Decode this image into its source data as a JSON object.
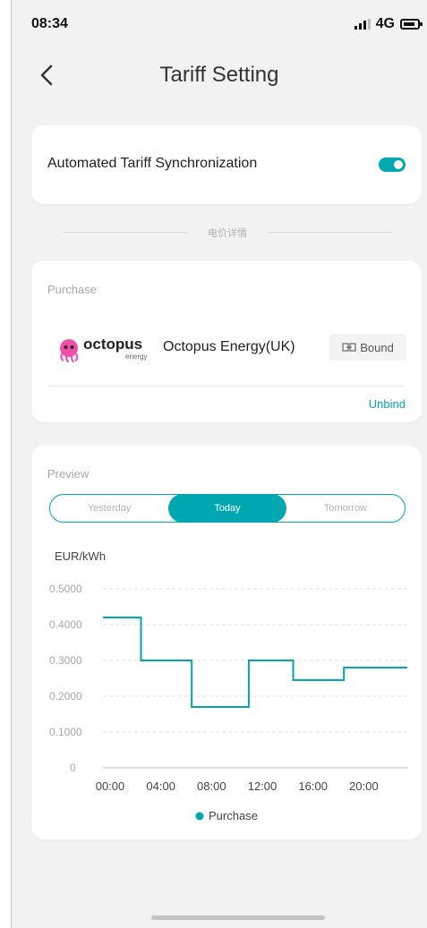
{
  "status_bar": {
    "time": "08:34",
    "network": "4G"
  },
  "header": {
    "title": "Tariff Setting"
  },
  "sync": {
    "label": "Automated Tariff Synchronization",
    "enabled": true
  },
  "section_divider": "电价详情",
  "purchase": {
    "caption": "Purchase",
    "logo_text": "octopus",
    "logo_subtext": "energy",
    "provider": "Octopus Energy(UK)",
    "status": "Bound",
    "unbind": "Unbind"
  },
  "preview": {
    "caption": "Preview",
    "tabs": [
      "Yesterday",
      "Today",
      "Tomorrow"
    ],
    "active_tab": "Today"
  },
  "colors": {
    "accent": "#00a6b0",
    "logo_pink": "#f050a8"
  },
  "chart_data": {
    "type": "line",
    "step": true,
    "ylabel": "EUR/kWh",
    "ylim": [
      0,
      0.5
    ],
    "yticks": [
      "0.5000",
      "0.4000",
      "0.3000",
      "0.2000",
      "0.1000",
      "0"
    ],
    "ytick_values": [
      0.5,
      0.4,
      0.3,
      0.2,
      0.1,
      0
    ],
    "xlim": [
      0,
      24
    ],
    "xticks": [
      "00:00",
      "04:00",
      "08:00",
      "12:00",
      "16:00",
      "20:00"
    ],
    "xtick_values": [
      0,
      4,
      8,
      12,
      16,
      20
    ],
    "grid": true,
    "legend": "bottom",
    "series": [
      {
        "name": "Purchase",
        "color": "#00a6b0",
        "points": [
          {
            "x": 0,
            "y": 0.42
          },
          {
            "x": 3,
            "y": 0.3
          },
          {
            "x": 7,
            "y": 0.17
          },
          {
            "x": 11.5,
            "y": 0.3
          },
          {
            "x": 15,
            "y": 0.245
          },
          {
            "x": 19,
            "y": 0.28
          },
          {
            "x": 24,
            "y": 0.28
          }
        ]
      }
    ]
  }
}
